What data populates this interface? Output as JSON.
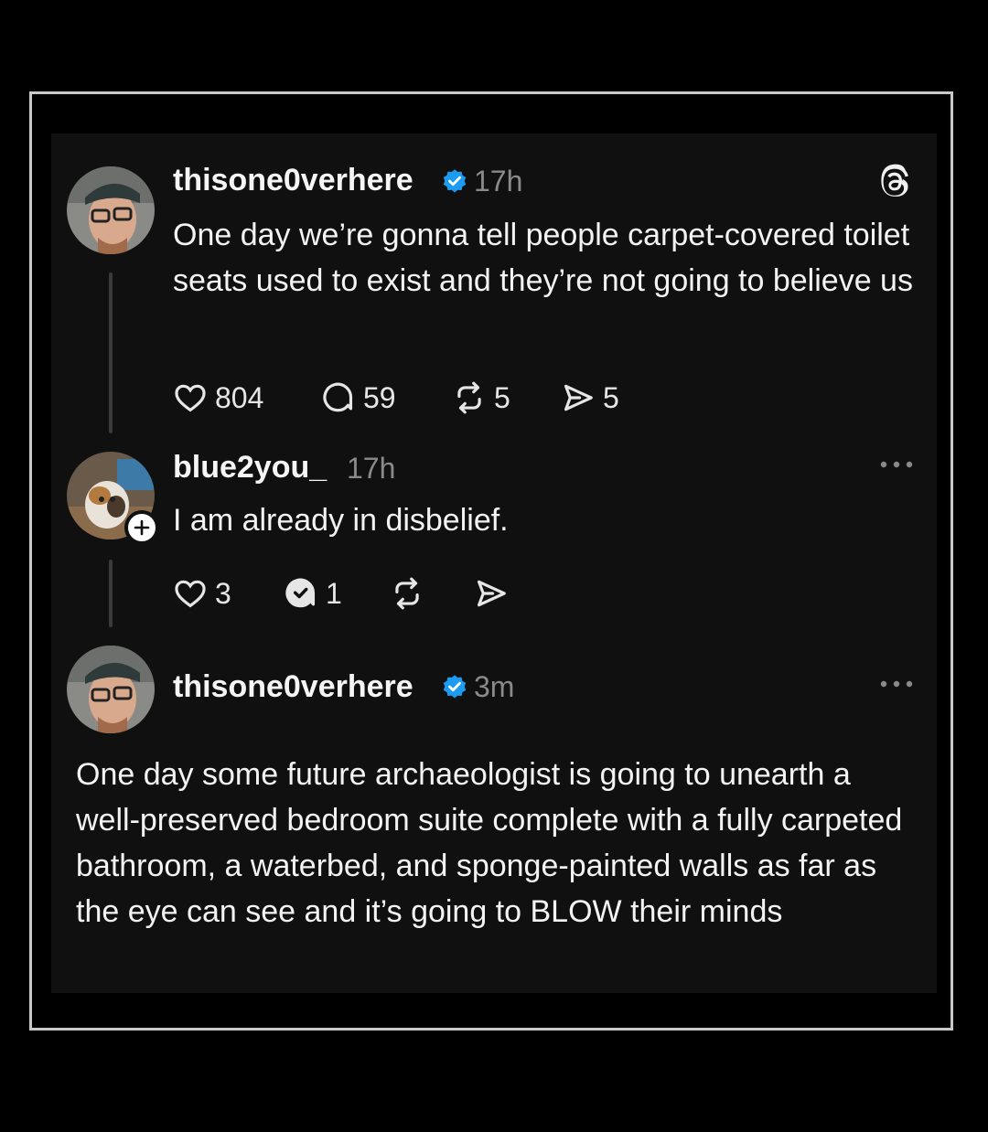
{
  "post1": {
    "username": "thisone0verhere",
    "timestamp": "17h",
    "text": "One day we’re gonna tell people carpet-covered toilet seats used to exist and they’re not going to believe us",
    "likes": "804",
    "replies": "59",
    "reposts": "5",
    "shares": "5"
  },
  "reply": {
    "username": "blue2you_",
    "timestamp": "17h",
    "text": "I am already in disbelief.",
    "likes": "3",
    "replies": "1"
  },
  "post2": {
    "username": "thisone0verhere",
    "timestamp": "3m",
    "text": "One day some future archaeologist is going to unearth a well-preserved bedroom suite complete with a fully carpeted bathroom, a waterbed, and sponge-painted walls as far as the eye can see and it’s going to BLOW their minds"
  },
  "colors": {
    "background": "#000000",
    "card": "#101010",
    "verified": "#1d9bf0",
    "muted": "#8a8a8a"
  },
  "icons": [
    "threads-logo-icon",
    "verified-icon",
    "heart-icon",
    "comment-icon",
    "repost-icon",
    "share-icon",
    "more-icon",
    "follow-plus-icon"
  ]
}
